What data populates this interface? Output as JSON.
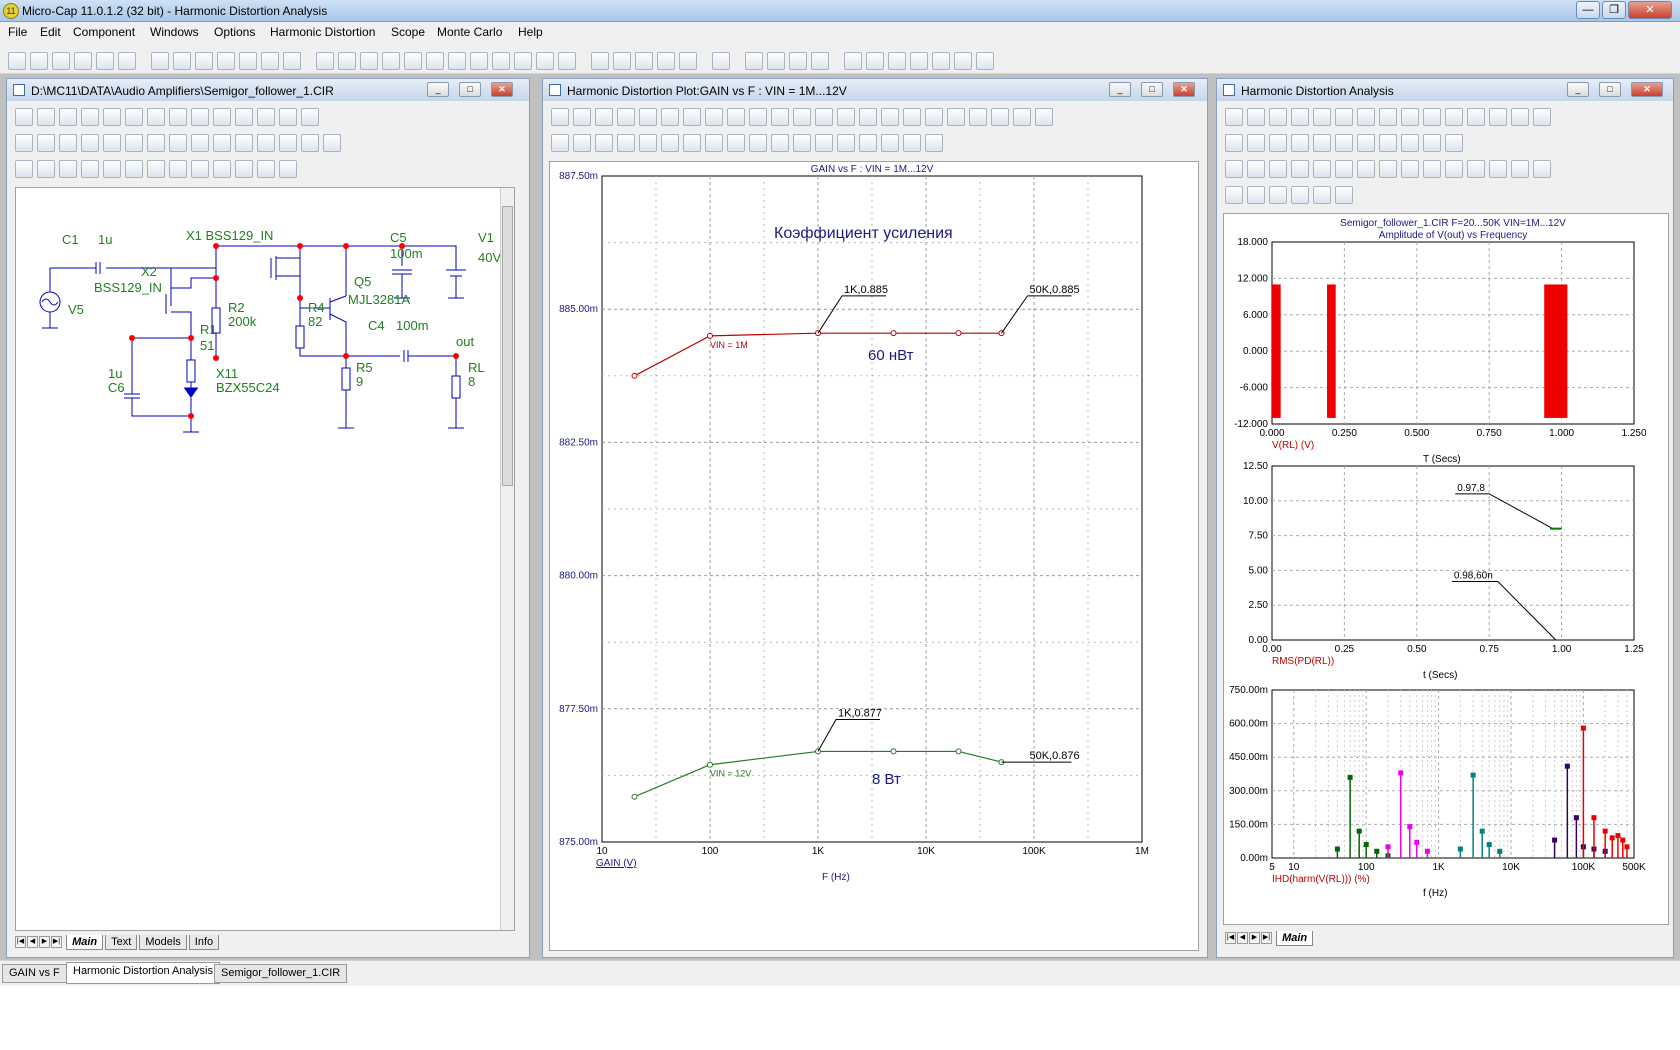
{
  "window": {
    "title": "Micro-Cap 11.0.1.2 (32 bit) - Harmonic Distortion Analysis",
    "icon_text": "11"
  },
  "menu": [
    "File",
    "Edit",
    "Component",
    "Windows",
    "Options",
    "Harmonic Distortion",
    "Scope",
    "Monte Carlo",
    "Help"
  ],
  "schematic": {
    "title": "D:\\MC11\\DATA\\Audio Amplifiers\\Semigor_follower_1.CIR",
    "labels": {
      "c1": "C1",
      "c1v": "1u",
      "x1": "X1 BSS129_IN",
      "x2": "X2",
      "x2v": "BSS129_IN",
      "c5": "C5",
      "c5v": "100m",
      "v1": "V1",
      "v1v": "40V",
      "q5": "Q5",
      "q5v": "MJL3281A",
      "r2": "R2",
      "r2v": "200k",
      "r4": "R4",
      "r4v": "82",
      "v5": "V5",
      "r1": "R1",
      "r1v": "51",
      "c4": "C4",
      "c4v": "100m",
      "out": "out",
      "c6v": "1u",
      "c6": "C6",
      "x11": "X11",
      "x11v": "BZX55C24",
      "r5": "R5",
      "r5v": "9",
      "rl": "RL",
      "rlv": "8"
    },
    "tabs": [
      "Main",
      "Text",
      "Models",
      "Info"
    ]
  },
  "plot": {
    "title": "Harmonic Distortion Plot:GAIN vs F : VIN = 1M...12V",
    "chart_data": {
      "type": "line",
      "title": "GAIN vs F : VIN = 1M...12V",
      "xlabel": "F (Hz)",
      "ylabel": "GAIN (V)",
      "xscale": "log",
      "xlim": [
        10,
        1000000
      ],
      "ylim": [
        0.875,
        0.8875
      ],
      "yticks": [
        "887.50m",
        "885.00m",
        "882.50m",
        "880.00m",
        "877.50m",
        "875.00m"
      ],
      "xticks": [
        "10",
        "100",
        "1K",
        "10K",
        "100K",
        "1M"
      ],
      "grid": true,
      "series": [
        {
          "name": "VIN = 1M",
          "color": "#c00000",
          "x": [
            20,
            100,
            1000,
            5000,
            20000,
            50000
          ],
          "y": [
            0.88375,
            0.8845,
            0.88455,
            0.88455,
            0.88455,
            0.88455
          ]
        },
        {
          "name": "VIN = 12V",
          "color": "#207a20",
          "x": [
            20,
            100,
            1000,
            5000,
            20000,
            50000
          ],
          "y": [
            0.87585,
            0.87645,
            0.8767,
            0.8767,
            0.8767,
            0.8765
          ]
        }
      ],
      "annotations": {
        "a1": "1K,0.885",
        "a2": "50K,0.885",
        "a3": "1K,0.877",
        "a4": "50K,0.876",
        "gain_label": "Коэффициент усиления",
        "p1": "60 нВт",
        "p2": "8 Вт"
      }
    }
  },
  "hda": {
    "title": "Harmonic Distortion Analysis",
    "chart_data": [
      {
        "type": "bar",
        "title": "Semigor_follower_1.CIR F=20...50K VIN=1M...12V",
        "subtitle": "Amplitude of V(out) vs Frequency",
        "xlabel": "T (Secs)",
        "ylabel": "V(RL) (V)",
        "xlim": [
          0,
          1.25
        ],
        "ylim": [
          -12,
          18
        ],
        "xticks": [
          "0.000",
          "0.250",
          "0.500",
          "0.750",
          "1.000",
          "1.250"
        ],
        "yticks": [
          "18.000",
          "12.000",
          "6.000",
          "0.000",
          "-6.000",
          "-12.000"
        ],
        "bursts": [
          {
            "x0": 0.0,
            "x1": 0.03
          },
          {
            "x0": 0.19,
            "x1": 0.22
          },
          {
            "x0": 0.94,
            "x1": 1.02
          }
        ],
        "amplitude": 11
      },
      {
        "type": "line",
        "xlabel": "t (Secs)",
        "ylabel": "RMS(PD(RL))",
        "xlim": [
          0,
          1.25
        ],
        "ylim": [
          0,
          12.5
        ],
        "xticks": [
          "0.00",
          "0.25",
          "0.50",
          "0.75",
          "1.00",
          "1.25"
        ],
        "yticks": [
          "12.50",
          "10.00",
          "7.50",
          "5.00",
          "2.50",
          "0.00"
        ],
        "labels": {
          "l1": "0.97,8",
          "l2": "0.98,60n"
        }
      },
      {
        "type": "bar",
        "xlabel": "f (Hz)",
        "ylabel": "IHD(harm(V(RL))) (%)",
        "xscale": "log",
        "xlim": [
          5,
          500000
        ],
        "ylim": [
          0,
          0.75
        ],
        "xticks": [
          "5",
          "10",
          "100",
          "1K",
          "10K",
          "100K",
          "500K"
        ],
        "yticks": [
          "750.00m",
          "600.00m",
          "450.00m",
          "300.00m",
          "150.00m",
          "0.00m"
        ],
        "series": [
          {
            "color": "#006600",
            "x": [
              40,
              60,
              80,
              100,
              140,
              200
            ],
            "y": [
              0.04,
              0.36,
              0.12,
              0.06,
              0.03,
              0.01
            ]
          },
          {
            "color": "#ee00ee",
            "x": [
              200,
              300,
              400,
              500,
              700
            ],
            "y": [
              0.05,
              0.38,
              0.14,
              0.07,
              0.03
            ]
          },
          {
            "color": "#008080",
            "x": [
              2000,
              3000,
              4000,
              5000,
              7000
            ],
            "y": [
              0.04,
              0.37,
              0.12,
              0.06,
              0.03
            ]
          },
          {
            "color": "#330066",
            "x": [
              40000,
              60000,
              80000,
              100000,
              140000,
              200000
            ],
            "y": [
              0.08,
              0.41,
              0.18,
              0.05,
              0.04,
              0.03
            ]
          },
          {
            "color": "#ee0000",
            "x": [
              100000,
              140000,
              200000,
              250000,
              300000,
              350000,
              400000
            ],
            "y": [
              0.58,
              0.18,
              0.12,
              0.09,
              0.1,
              0.08,
              0.05
            ]
          }
        ]
      }
    ],
    "tabs": [
      "Main"
    ]
  },
  "taskbar": [
    "GAIN vs F",
    "Harmonic Distortion Analysis",
    "Semigor_follower_1.CIR"
  ]
}
